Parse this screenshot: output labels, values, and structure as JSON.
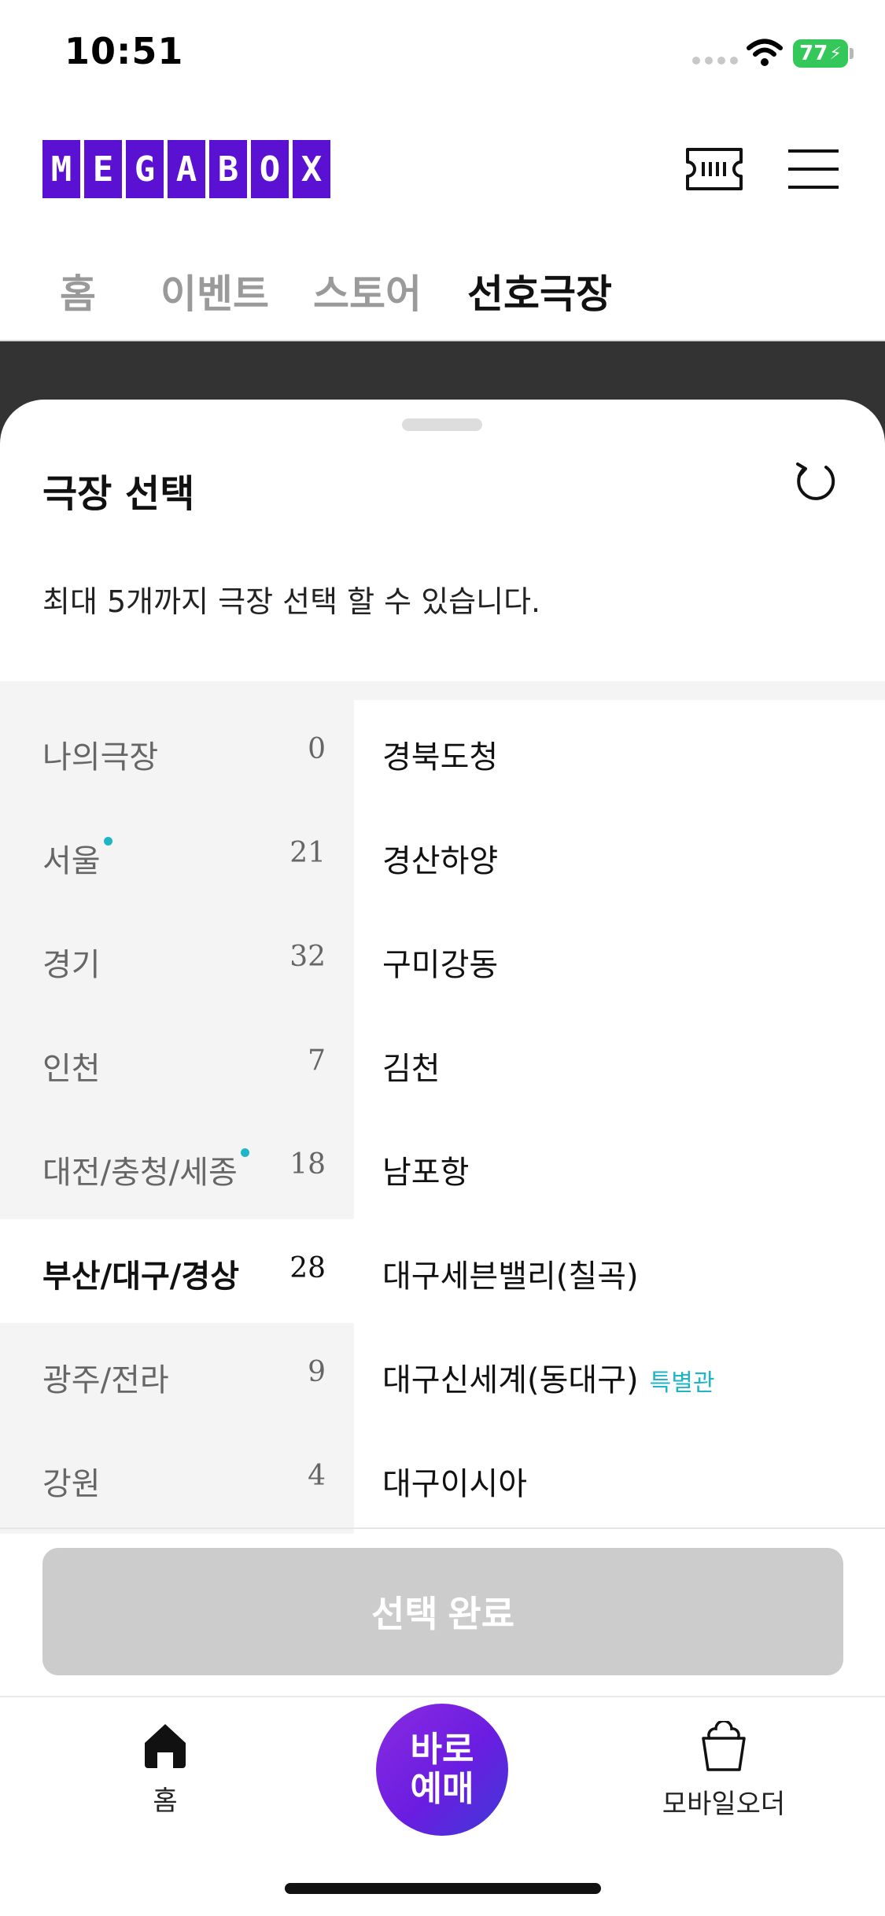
{
  "status_bar": {
    "time": "10:51",
    "battery": "77"
  },
  "header": {
    "logo_letters": [
      "M",
      "E",
      "G",
      "A",
      "B",
      "O",
      "X"
    ],
    "tabs": [
      {
        "label": "홈",
        "active": false
      },
      {
        "label": "이벤트",
        "active": false
      },
      {
        "label": "스토어",
        "active": false
      },
      {
        "label": "선호극장",
        "active": true
      }
    ]
  },
  "sheet": {
    "title": "극장 선택",
    "description": "최대 5개까지 극장 선택 할 수 있습니다.",
    "regions": [
      {
        "name": "나의극장",
        "count": "0",
        "new": false,
        "selected": false
      },
      {
        "name": "서울",
        "count": "21",
        "new": true,
        "selected": false
      },
      {
        "name": "경기",
        "count": "32",
        "new": false,
        "selected": false
      },
      {
        "name": "인천",
        "count": "7",
        "new": false,
        "selected": false
      },
      {
        "name": "대전/충청/세종",
        "count": "18",
        "new": true,
        "selected": false
      },
      {
        "name": "부산/대구/경상",
        "count": "28",
        "new": false,
        "selected": true
      },
      {
        "name": "광주/전라",
        "count": "9",
        "new": false,
        "selected": false
      },
      {
        "name": "강원",
        "count": "4",
        "new": false,
        "selected": false
      }
    ],
    "theaters": [
      {
        "name": "경북도청",
        "tag": ""
      },
      {
        "name": "경산하양",
        "tag": ""
      },
      {
        "name": "구미강동",
        "tag": ""
      },
      {
        "name": "김천",
        "tag": ""
      },
      {
        "name": "남포항",
        "tag": ""
      },
      {
        "name": "대구세븐밸리(칠곡)",
        "tag": ""
      },
      {
        "name": "대구신세계(동대구)",
        "tag": "특별관"
      },
      {
        "name": "대구이시아",
        "tag": ""
      }
    ],
    "confirm_label": "선택 완료"
  },
  "tabbar": {
    "home_label": "홈",
    "book_line1": "바로",
    "book_line2": "예매",
    "order_label": "모바일오더"
  },
  "colors": {
    "brand": "#5b11d2",
    "accent": "#1eb5c8",
    "disabled": "#cccccc"
  },
  "icons": [
    "wifi-icon",
    "battery-icon",
    "ticket-icon",
    "menu-icon",
    "refresh-icon",
    "home-icon",
    "popcorn-icon"
  ]
}
